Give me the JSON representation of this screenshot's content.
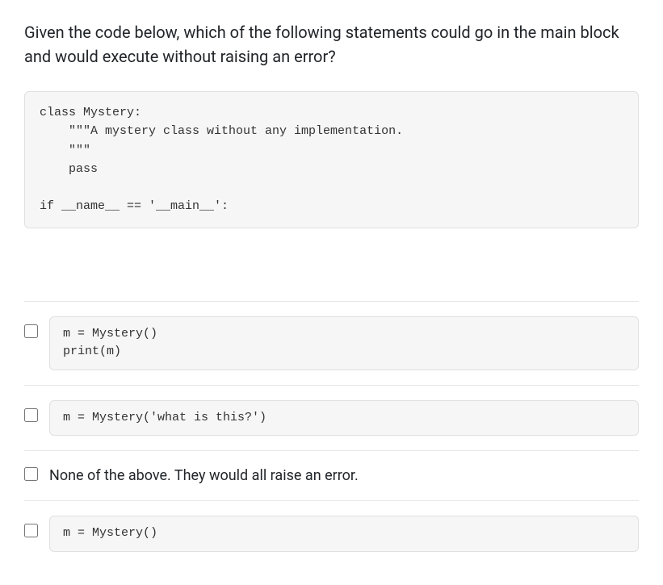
{
  "question": "Given the code below, which of the following statements could go in the main block and would execute without raising an error?",
  "code_block": "class Mystery:\n    \"\"\"A mystery class without any implementation.\n    \"\"\"\n    pass\n\nif __name__ == '__main__':",
  "options": [
    {
      "type": "code",
      "content": "m = Mystery()\nprint(m)"
    },
    {
      "type": "code",
      "content": "m = Mystery('what is this?')"
    },
    {
      "type": "text",
      "content": "None of the above. They would all raise an error."
    },
    {
      "type": "code",
      "content": "m = Mystery()"
    }
  ]
}
